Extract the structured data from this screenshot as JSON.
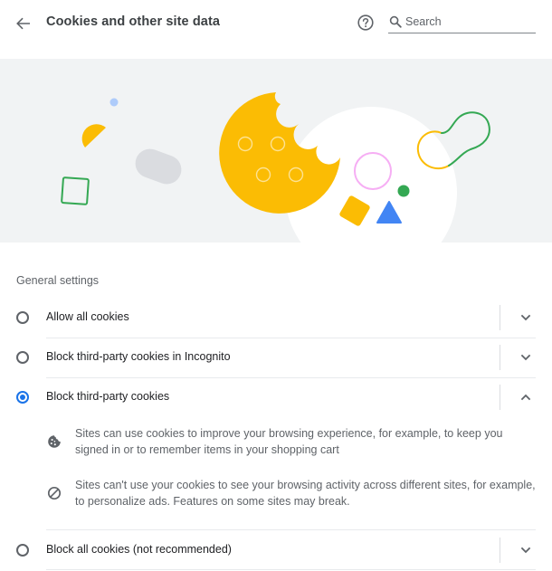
{
  "header": {
    "title": "Cookies and other site data",
    "back_icon": "arrow-back-icon",
    "help_icon": "help-icon",
    "search_placeholder": "Search",
    "search_value": ""
  },
  "general": {
    "heading": "General settings",
    "options": [
      {
        "label": "Allow all cookies",
        "checked": false,
        "expanded": false
      },
      {
        "label": "Block third-party cookies in Incognito",
        "checked": false,
        "expanded": false
      },
      {
        "label": "Block third-party cookies",
        "checked": true,
        "expanded": true
      },
      {
        "label": "Block all cookies (not recommended)",
        "checked": false,
        "expanded": false
      }
    ],
    "details": [
      {
        "icon": "cookie-icon",
        "text": "Sites can use cookies to improve your browsing experience, for example, to keep you signed in or to remember items in your shopping cart"
      },
      {
        "icon": "block-icon",
        "text": "Sites can't use your cookies to see your browsing activity across different sites, for example, to personalize ads. Features on some sites may break."
      }
    ]
  },
  "colors": {
    "accent": "#1a73e8",
    "banner_bg": "#f1f3f4",
    "cookie_yellow": "#fbbc04",
    "green": "#34a853",
    "blue": "#4285f4",
    "pink": "#f28bf2"
  }
}
